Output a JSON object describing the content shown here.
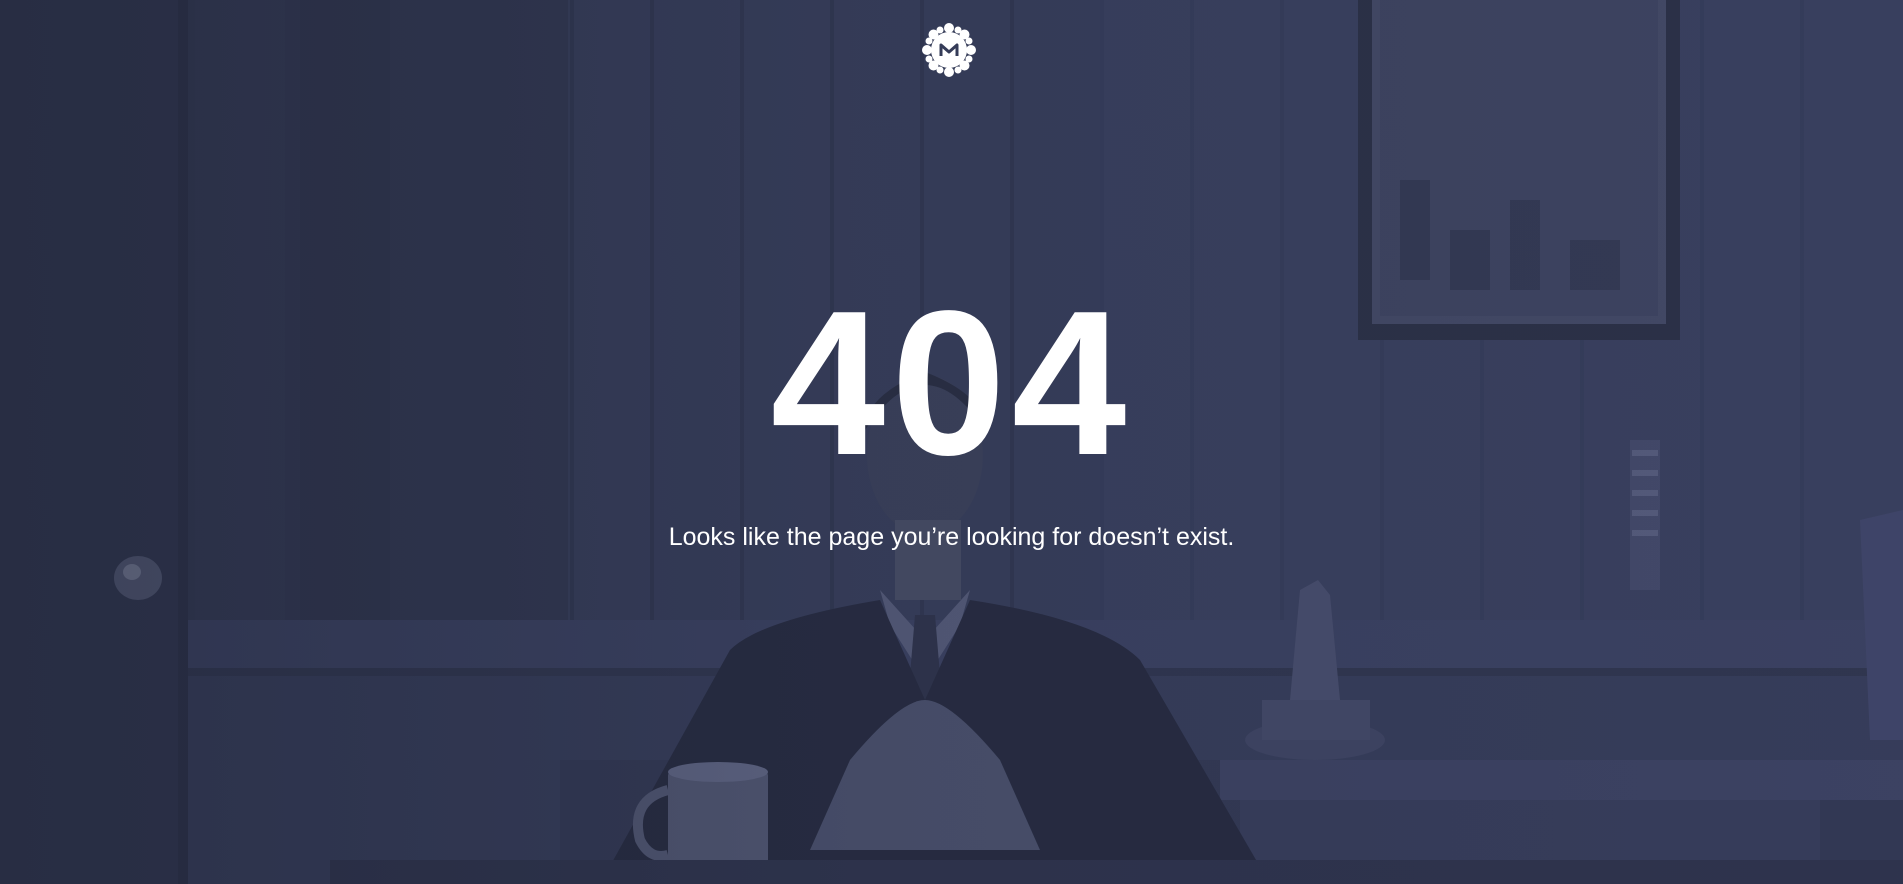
{
  "page": {
    "logo_icon": "medium-logo-icon",
    "error_code": "404",
    "message": "Looks like the page you’re looking for doesn’t exist."
  },
  "colors": {
    "background": "#2f3650",
    "text": "#ffffff",
    "overlay": "#3a4262"
  }
}
